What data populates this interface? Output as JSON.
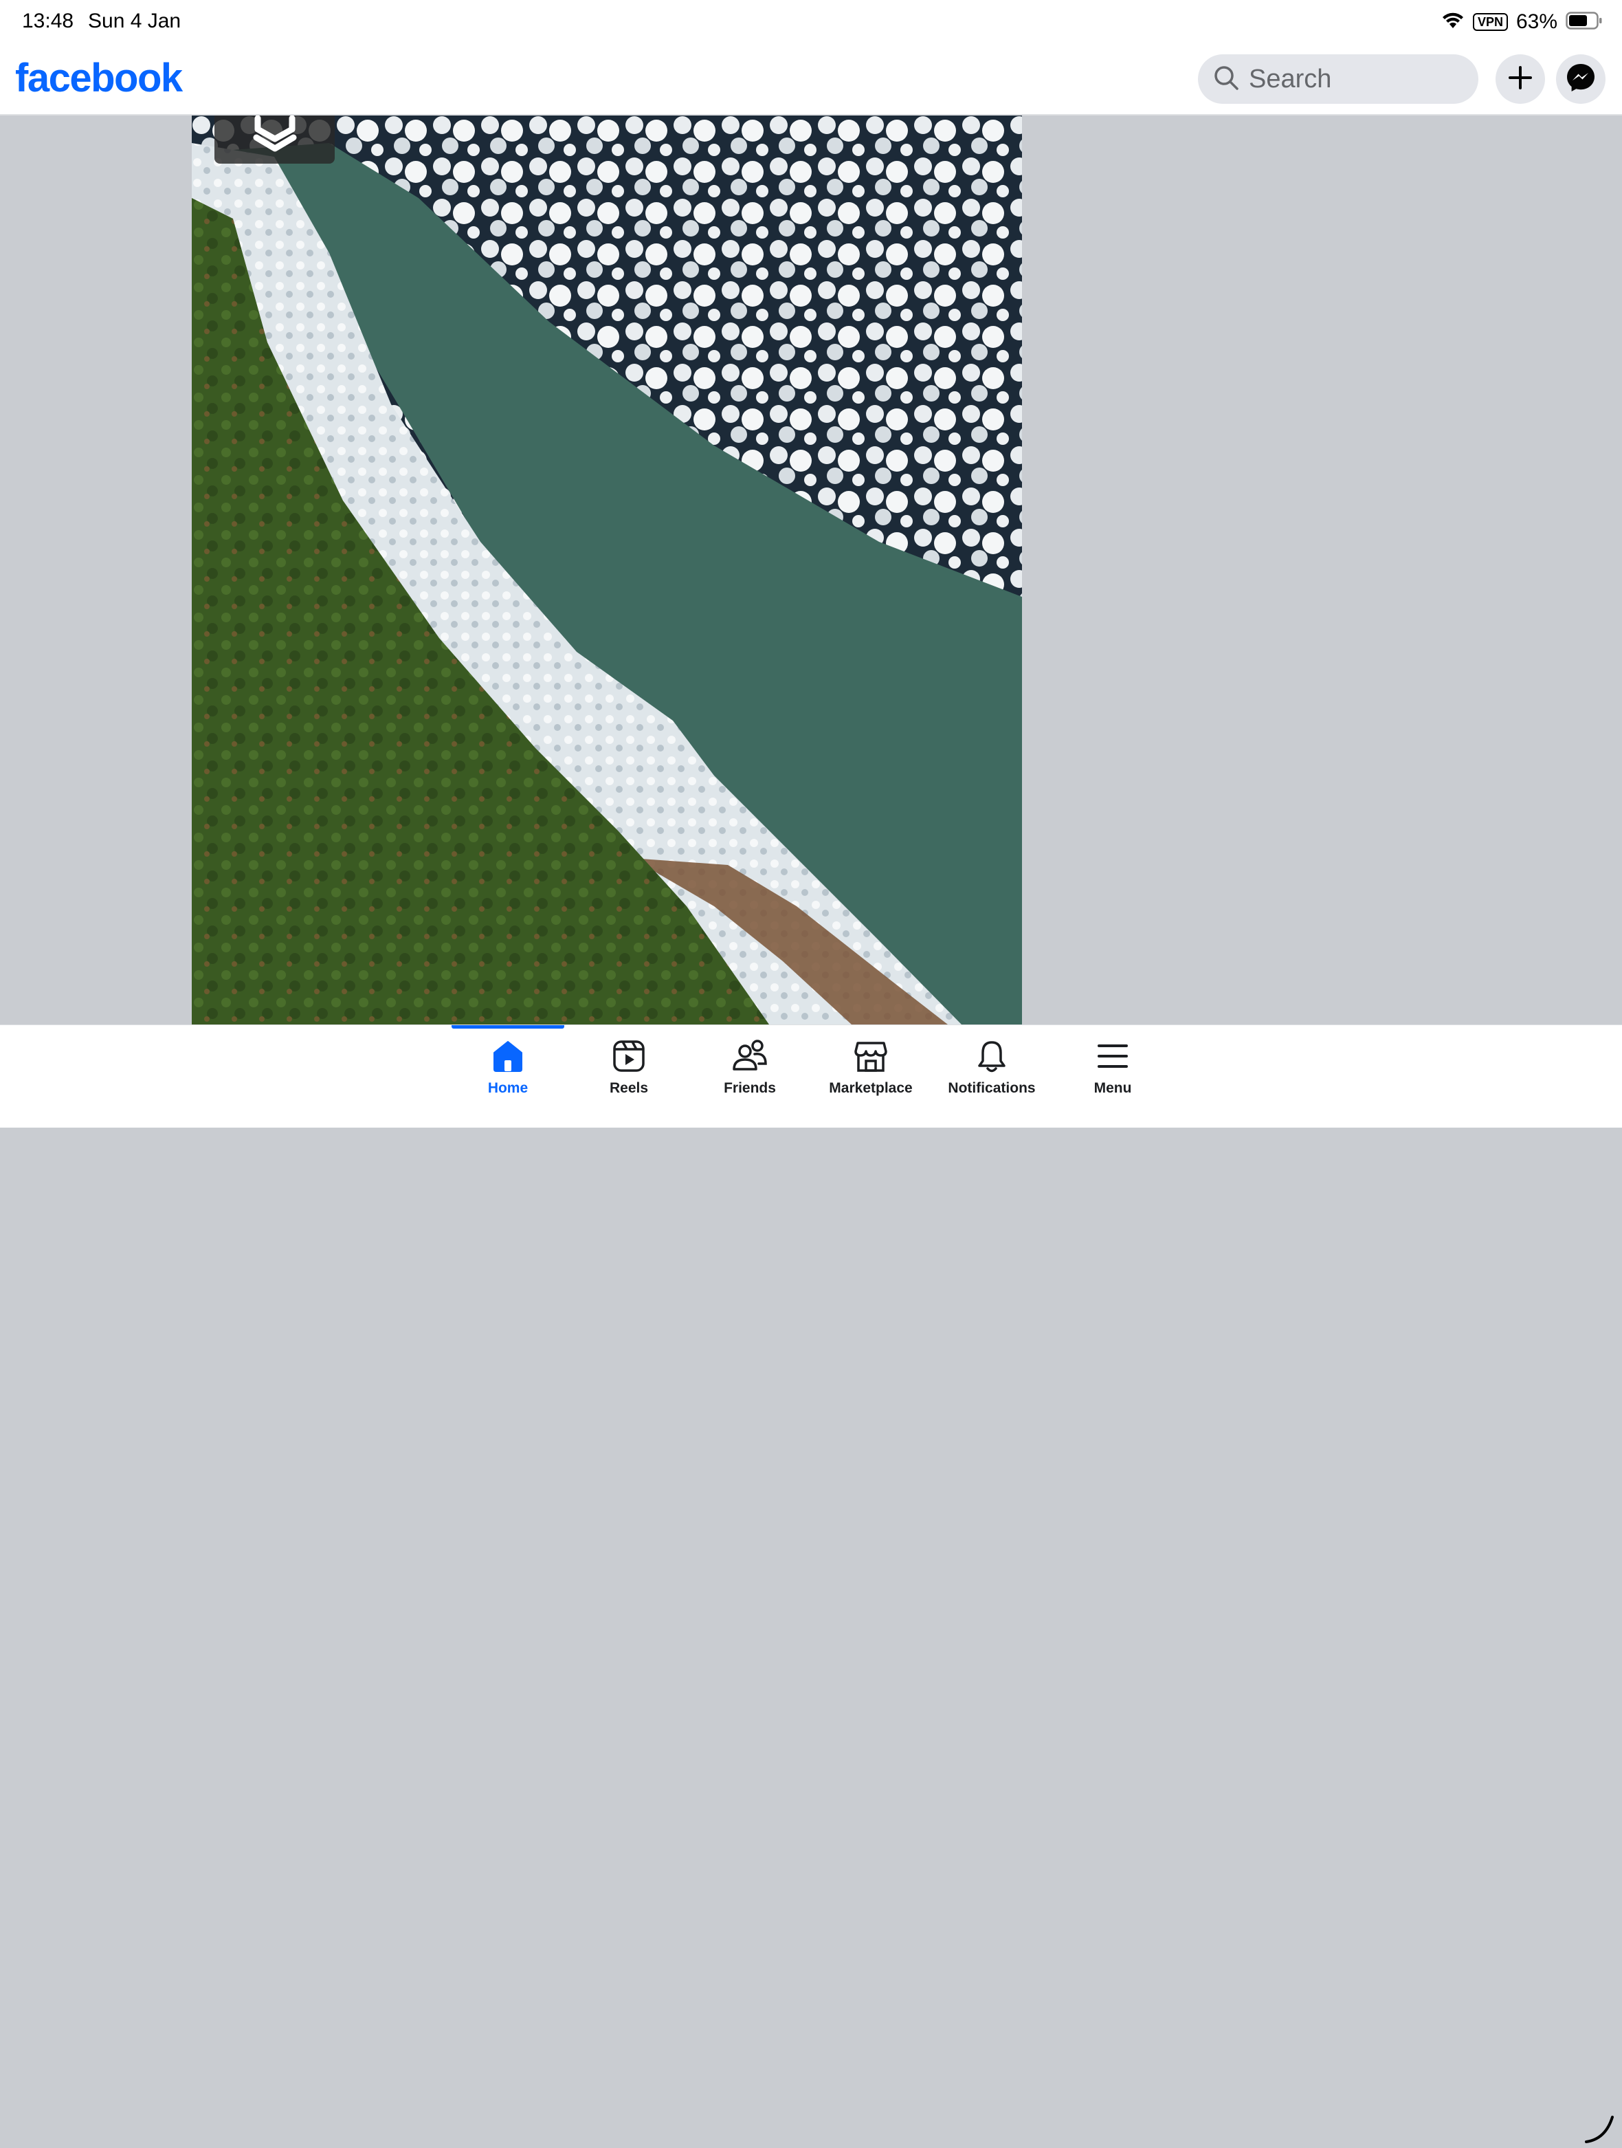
{
  "status_bar": {
    "time": "13:48",
    "date": "Sun 4 Jan",
    "vpn": "VPN",
    "battery": "63%",
    "icons": [
      "wifi-icon",
      "battery-icon"
    ]
  },
  "header": {
    "logo": "facebook",
    "search_placeholder": "Search",
    "brand_color": "#0866ff",
    "icons": [
      "search-icon",
      "plus-icon",
      "messenger-icon"
    ]
  },
  "feed": {
    "photo_subject": "satellite-coastline-photo"
  },
  "bottom_nav": {
    "active": "Home",
    "items": [
      {
        "label": "Home",
        "icon": "home-icon"
      },
      {
        "label": "Reels",
        "icon": "reels-icon"
      },
      {
        "label": "Friends",
        "icon": "friends-icon"
      },
      {
        "label": "Marketplace",
        "icon": "marketplace-icon"
      },
      {
        "label": "Notifications",
        "icon": "bell-icon"
      },
      {
        "label": "Menu",
        "icon": "menu-icon"
      }
    ]
  }
}
